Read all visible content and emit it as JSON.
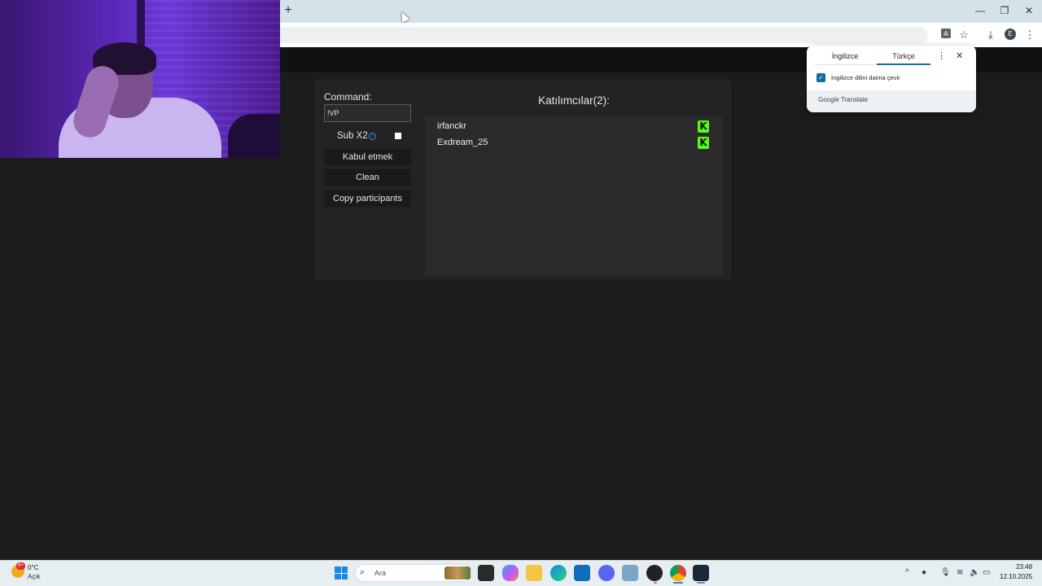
{
  "browser": {
    "new_tab_symbol": "+",
    "window_controls": [
      "—",
      "❐",
      "✕"
    ],
    "profile_initial": "E"
  },
  "app": {
    "command_label": "Command:",
    "command_value": "!VP",
    "sub_label": "Sub X2",
    "sub_checked": false,
    "buttons": [
      "Kabul etmek",
      "Clean",
      "Copy participants"
    ],
    "participants_title": "Katılımcılar(2):",
    "participants": [
      {
        "name": "irfanckr",
        "platform_icon": "kick-icon"
      },
      {
        "name": "Exdream_25",
        "platform_icon": "kick-icon"
      }
    ],
    "kick_letter": "K",
    "kick_color": "#53fc18"
  },
  "translate": {
    "tab_source": "İngilizce",
    "tab_target": "Türkçe",
    "always_translate": "İngilizce dilini daima çevir",
    "always_checked": true,
    "footer": "Google Translate"
  },
  "taskbar": {
    "weather_badge": "9+",
    "weather_temp": "0°C",
    "weather_desc": "Açık",
    "search_placeholder": "Ara",
    "time": "23:48",
    "date": "12.10.2025"
  }
}
